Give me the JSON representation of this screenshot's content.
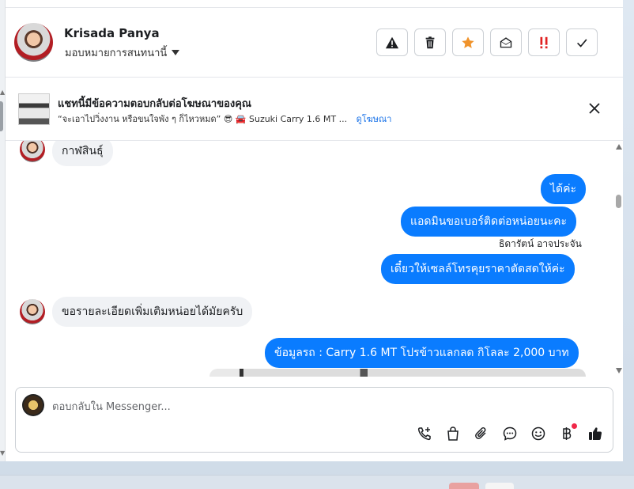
{
  "header": {
    "contact_name": "Krisada Panya",
    "assign_label": "มอบหมายการสนทนานี้",
    "actions": [
      "warning-icon",
      "trash-icon",
      "star-icon",
      "envelope-open-icon",
      "exclamation-icon",
      "check-icon"
    ]
  },
  "ad_banner": {
    "title": "แชทนี้มีข้อความตอบกลับต่อโฆษณาของคุณ",
    "subtitle": "“จะเอาไปวิ่งงาน หรือขนใจพัง ๆ ก็ไหวหมด” 😎 🚘 Suzuki Carry 1.6 MT ...",
    "link_label": "ดูโฆษณา"
  },
  "messages": {
    "in_1": "กาฬสินธุ์",
    "out_1": "ได้ค่ะ",
    "out_2": "แอดมินขอเบอร์ติดต่อหน่อยนะคะ",
    "sender_out": "ธิดารัตน์ อาจประจัน",
    "out_3": "เดี๋ยวให้เซลล์โทรคุยราคาตัดสดให้ค่ะ",
    "in_2": "ขอรายละเอียดเพิ่มเติมหน่อยได้มัยครับ",
    "out_4": "ข้อมูลรถ : Carry 1.6 MT โปรข้าวแลกลด กิโลละ 2,000 บาท"
  },
  "composer": {
    "placeholder": "ตอบกลับใน Messenger...",
    "tools": [
      "phone-plus-icon",
      "shopping-bag-icon",
      "paperclip-icon",
      "chat-bubble-icon",
      "emoji-icon",
      "baht-icon",
      "thumbs-up-icon"
    ]
  },
  "colors": {
    "accent": "#0a7cff",
    "star": "#f0932b",
    "danger": "#e02020"
  }
}
